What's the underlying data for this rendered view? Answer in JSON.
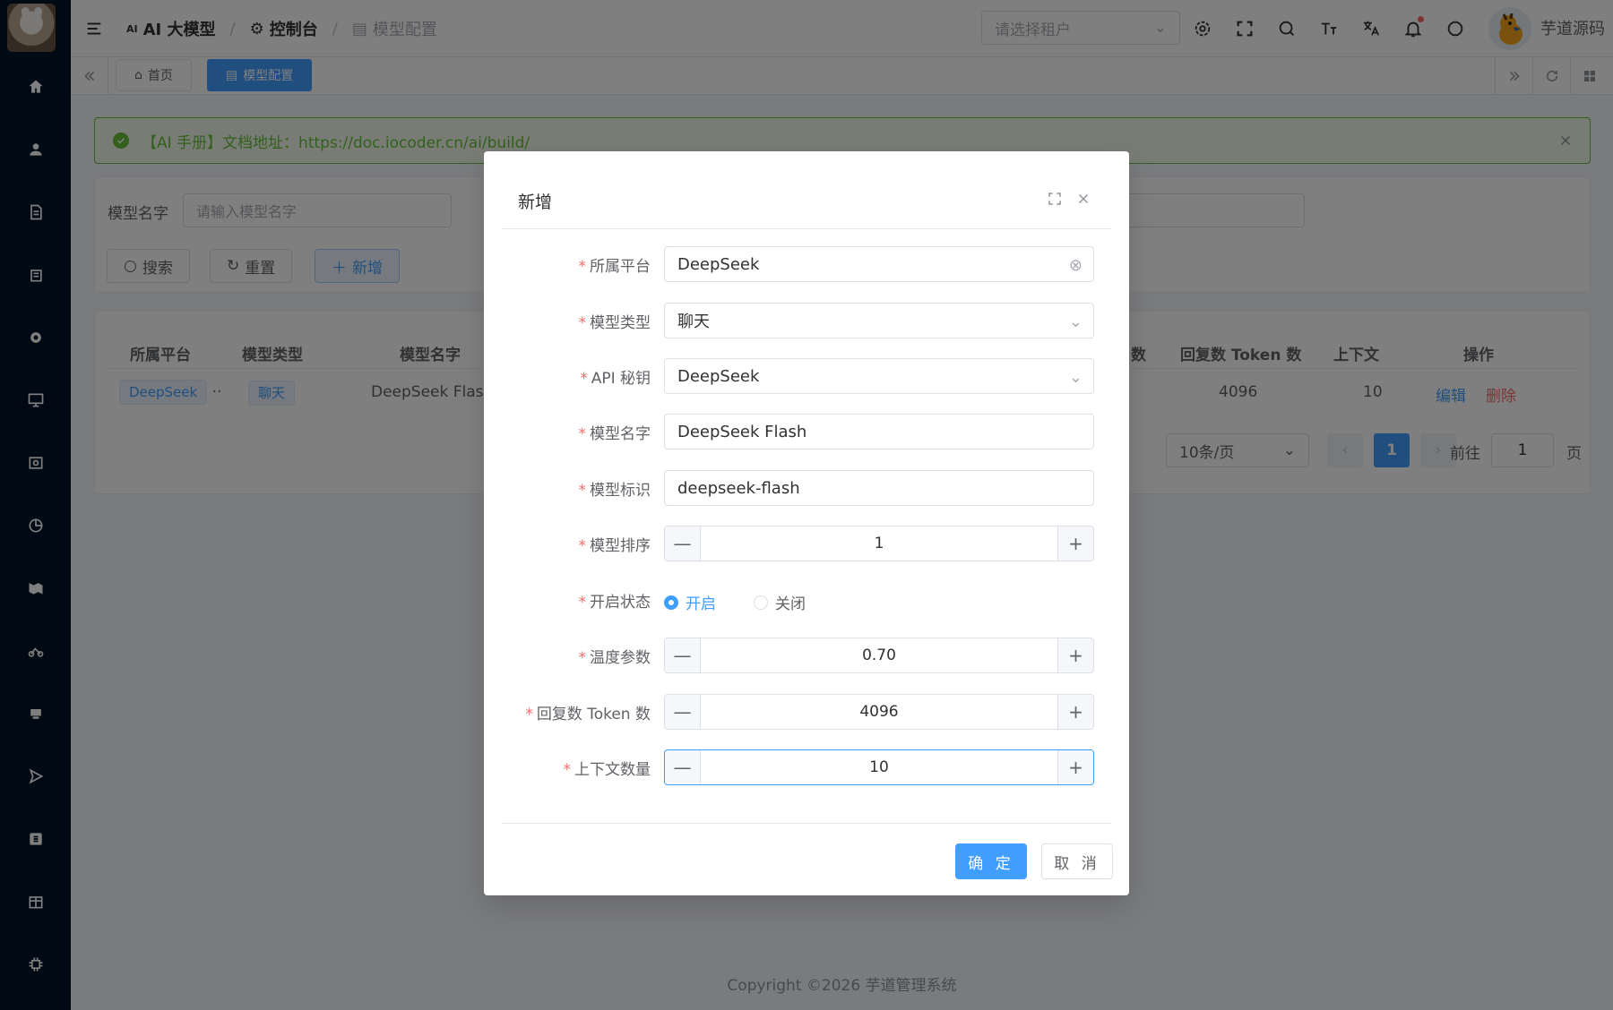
{
  "header": {
    "breadcrumb": [
      {
        "label": "AI 大模型",
        "icon": "ai-icon"
      },
      {
        "label": "控制台",
        "icon": "gear-icon"
      },
      {
        "label": "模型配置",
        "icon": "model-icon"
      }
    ],
    "tenant_placeholder": "请选择租户",
    "username": "芋道源码"
  },
  "tabs": [
    {
      "label": "首页",
      "icon": "home-icon"
    },
    {
      "label": "模型配置",
      "icon": "model-icon",
      "active": true
    }
  ],
  "alert": {
    "text": "【AI 手册】文档地址：https://doc.iocoder.cn/ai/build/"
  },
  "search": {
    "label": "模型名字",
    "placeholder": "请输入模型名字",
    "search_btn": "搜索",
    "reset_btn": "重置",
    "add_btn": "新增"
  },
  "table": {
    "headers": [
      "所属平台",
      "模型类型",
      "模型名字",
      "数",
      "回复数 Token 数",
      "上下文",
      "操作"
    ],
    "row": {
      "platform": "DeepSeek",
      "more": "··",
      "type": "聊天",
      "name": "DeepSeek Flash",
      "max_tokens": "4096",
      "context": "10",
      "edit": "编辑",
      "delete": "删除"
    }
  },
  "pager": {
    "page_size": "10条/页",
    "current": "1",
    "goto_label": "前往",
    "goto_value": "1",
    "page_unit": "页"
  },
  "footer": {
    "copyright": "Copyright ©2026 芋道管理系统"
  },
  "dialog": {
    "title": "新增",
    "fields": {
      "platform": {
        "label": "所属平台",
        "value": "DeepSeek"
      },
      "type": {
        "label": "模型类型",
        "value": "聊天"
      },
      "api_key": {
        "label": "API 秘钥",
        "value": "DeepSeek"
      },
      "name": {
        "label": "模型名字",
        "value": "DeepSeek Flash"
      },
      "model": {
        "label": "模型标识",
        "value": "deepseek-flash"
      },
      "sort": {
        "label": "模型排序",
        "value": "1"
      },
      "status": {
        "label": "开启状态",
        "options": [
          "开启",
          "关闭"
        ],
        "selected": "开启"
      },
      "temperature": {
        "label": "温度参数",
        "value": "0.70"
      },
      "max_tokens": {
        "label": "回复数 Token 数",
        "value": "4096"
      },
      "max_contexts": {
        "label": "上下文数量",
        "value": "10"
      }
    },
    "required_mark": "*",
    "ok": "确 定",
    "cancel": "取 消"
  },
  "colors": {
    "primary": "#409eff",
    "success": "#67c23a",
    "danger": "#f56c6c",
    "sidebar": "#001529"
  }
}
